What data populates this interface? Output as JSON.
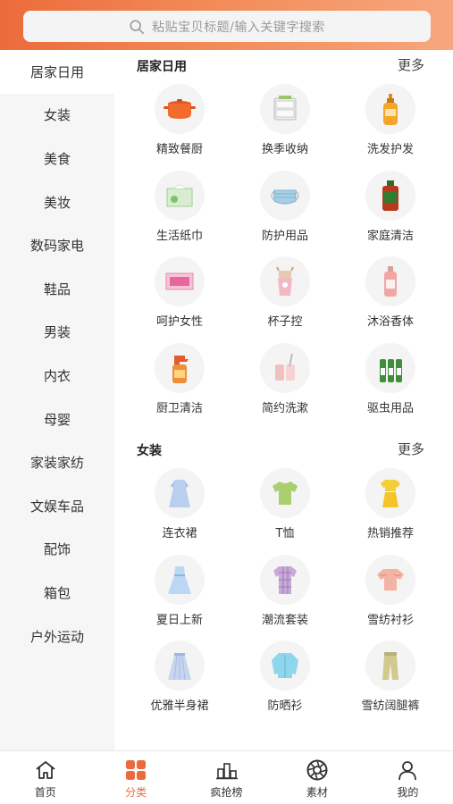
{
  "search": {
    "placeholder": "粘贴宝贝标题/输入关键字搜索"
  },
  "sidebar": {
    "items": [
      {
        "label": "居家日用"
      },
      {
        "label": "女装"
      },
      {
        "label": "美食"
      },
      {
        "label": "美妆"
      },
      {
        "label": "数码家电"
      },
      {
        "label": "鞋品"
      },
      {
        "label": "男装"
      },
      {
        "label": "内衣"
      },
      {
        "label": "母婴"
      },
      {
        "label": "家装家纺"
      },
      {
        "label": "文娱车品"
      },
      {
        "label": "配饰"
      },
      {
        "label": "箱包"
      },
      {
        "label": "户外运动"
      }
    ],
    "active_index": 0
  },
  "sections": [
    {
      "title": "居家日用",
      "more_label": "更多",
      "items": [
        {
          "label": "精致餐厨",
          "icon": "pot-icon"
        },
        {
          "label": "换季收纳",
          "icon": "storage-drawer-icon"
        },
        {
          "label": "洗发护发",
          "icon": "shampoo-bottle-icon"
        },
        {
          "label": "生活纸巾",
          "icon": "tissue-box-icon"
        },
        {
          "label": "防护用品",
          "icon": "face-mask-icon"
        },
        {
          "label": "家庭清洁",
          "icon": "cleaner-bottle-icon"
        },
        {
          "label": "呵护女性",
          "icon": "sanitary-pad-icon"
        },
        {
          "label": "杯子控",
          "icon": "cup-icon"
        },
        {
          "label": "沐浴香体",
          "icon": "body-wash-bottle-icon"
        },
        {
          "label": "厨卫清洁",
          "icon": "spray-bottle-icon"
        },
        {
          "label": "简约洗漱",
          "icon": "toothbrush-cup-icon"
        },
        {
          "label": "驱虫用品",
          "icon": "repellent-bottles-icon"
        }
      ]
    },
    {
      "title": "女装",
      "more_label": "更多",
      "items": [
        {
          "label": "连衣裙",
          "icon": "dress-icon"
        },
        {
          "label": "T恤",
          "icon": "tshirt-icon"
        },
        {
          "label": "热销推荐",
          "icon": "yellow-outfit-icon"
        },
        {
          "label": "夏日上新",
          "icon": "summer-dress-icon"
        },
        {
          "label": "潮流套装",
          "icon": "plaid-set-icon"
        },
        {
          "label": "雪纺衬衫",
          "icon": "chiffon-blouse-icon"
        },
        {
          "label": "优雅半身裙",
          "icon": "skirt-icon"
        },
        {
          "label": "防晒衫",
          "icon": "sun-jacket-icon"
        },
        {
          "label": "雪纺阔腿裤",
          "icon": "wide-pants-icon"
        }
      ]
    }
  ],
  "tabbar": {
    "items": [
      {
        "label": "首页",
        "icon": "home-icon"
      },
      {
        "label": "分类",
        "icon": "category-grid-icon"
      },
      {
        "label": "疯抢榜",
        "icon": "ranking-icon"
      },
      {
        "label": "素材",
        "icon": "aperture-icon"
      },
      {
        "label": "我的",
        "icon": "person-icon"
      }
    ],
    "active_index": 1
  },
  "colors": {
    "accent": "#ec6b3c",
    "sidebar_bg": "#f6f6f6"
  }
}
